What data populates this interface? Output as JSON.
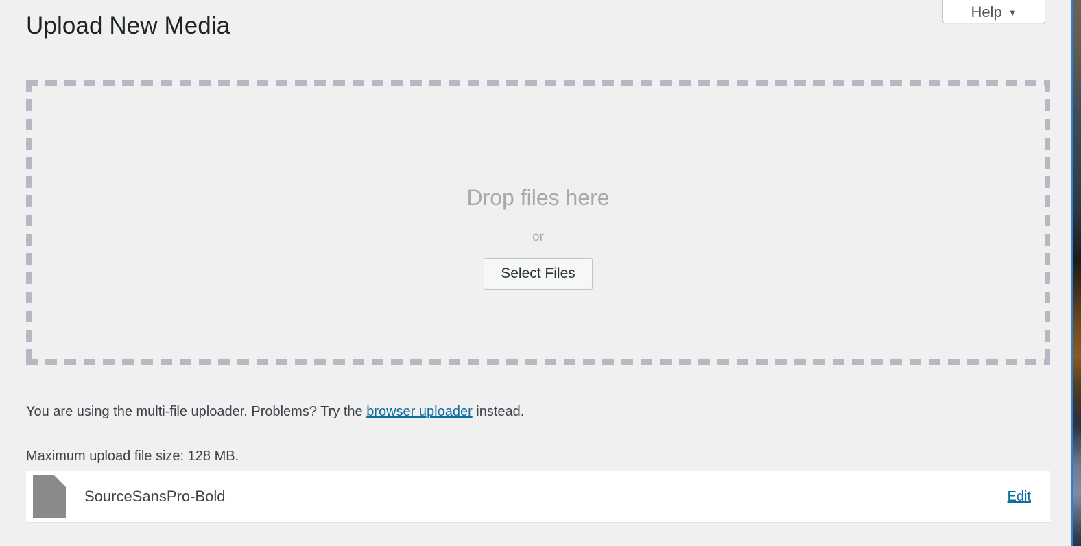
{
  "page": {
    "title": "Upload New Media",
    "background_color": "#f0f0f1"
  },
  "help_tab": {
    "label": "Help",
    "caret_icon": "chevron-down-icon",
    "caret_glyph": "▼"
  },
  "drop_zone": {
    "drop_text": "Drop files here",
    "or_text": "or",
    "select_files_label": "Select Files",
    "border_color": "#b4b9c2",
    "text_color": "#a7aaad"
  },
  "notes": {
    "uploader_prefix": "You are using the multi-file uploader. Problems? Try the ",
    "uploader_link_label": "browser uploader",
    "uploader_suffix": " instead.",
    "max_upload": "Maximum upload file size: 128 MB.",
    "link_color": "#0f6ea0"
  },
  "media_items": [
    {
      "icon": "file-document-icon",
      "filename": "SourceSansPro-Bold",
      "edit_label": "Edit"
    }
  ]
}
